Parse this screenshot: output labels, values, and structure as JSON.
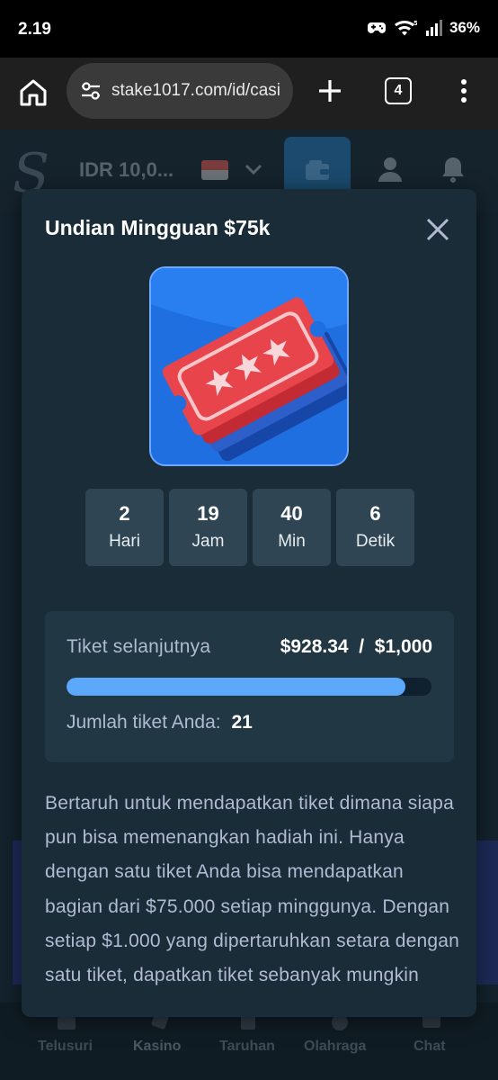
{
  "status_bar": {
    "time": "2.19",
    "battery": "36%"
  },
  "browser": {
    "url": "stake1017.com/id/casi",
    "tab_count": "4",
    "icons": [
      "home-icon",
      "site-settings-icon",
      "plus-icon",
      "tabs-icon",
      "more-vert-icon"
    ]
  },
  "site": {
    "balance": "IDR 10,0...",
    "bottom_nav": [
      "Telusuri",
      "Kasino",
      "Taruhan",
      "Olahraga",
      "Chat"
    ]
  },
  "modal": {
    "title": "Undian Mingguan $75k",
    "countdown": [
      {
        "value": "2",
        "unit": "Hari"
      },
      {
        "value": "19",
        "unit": "Jam"
      },
      {
        "value": "40",
        "unit": "Min"
      },
      {
        "value": "6",
        "unit": "Detik"
      }
    ],
    "progress": {
      "label": "Tiket selanjutnya",
      "value_text": "$928.34  /  $1,000",
      "current": 928.34,
      "target": 1000,
      "fraction": 0.928
    },
    "tickets": {
      "label": "Jumlah tiket Anda:",
      "count": "21"
    },
    "description": "Bertaruh untuk mendapatkan tiket dimana siapa pun bisa memenangkan hadiah ini. Hanya dengan satu tiket Anda bisa mendapatkan bagian dari $75.000 setiap minggunya. Dengan setiap $1.000 yang dipertaruhkan setara dengan satu tiket, dapatkan tiket sebanyak mungkin"
  },
  "colors": {
    "modal_bg": "#1a2c38",
    "card_bg": "#213743",
    "countdown_bg": "#2f4553",
    "progress_fill": "#5ca8fb",
    "muted_text": "#b1bad3"
  }
}
